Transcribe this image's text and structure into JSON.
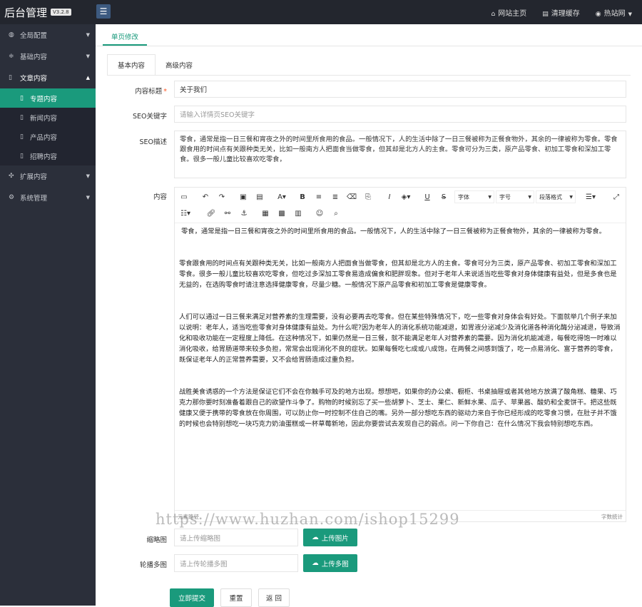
{
  "app": {
    "title": "后台管理",
    "version": "V3.2.8"
  },
  "top_nav": {
    "site_home": "网站主页",
    "clear_cache": "清理缓存",
    "user": "热站网"
  },
  "sidebar": {
    "items": [
      {
        "label": "全局配置",
        "icon": "globe-icon"
      },
      {
        "label": "基础内容",
        "icon": "sliders-icon"
      },
      {
        "label": "文章内容",
        "icon": "file-icon"
      },
      {
        "label": "扩展内容",
        "icon": "expand-icon"
      },
      {
        "label": "系统管理",
        "icon": "gear-icon"
      }
    ],
    "sub_items": [
      {
        "label": "专题内容"
      },
      {
        "label": "新闻内容"
      },
      {
        "label": "产品内容"
      },
      {
        "label": "招聘内容"
      }
    ]
  },
  "page_tab": "单页修改",
  "sub_tabs": [
    "基本内容",
    "高级内容"
  ],
  "form": {
    "title_label": "内容标题",
    "title_required": "*",
    "title_value": "关于我们",
    "seo_kw_label": "SEO关键字",
    "seo_kw_placeholder": "请输入详情页SEO关键字",
    "seo_desc_label": "SEO描述",
    "seo_desc_value": "零食，通常是指一日三餐和宵夜之外的时间里所食用的食品。一般情况下，人的生活中除了一日三餐被称为正餐食物外，其余的一律被称为零食。零食跟食用的时间点有关跟种类无关，比如一般南方人把面食当做零食，但其却是北方人的主食。零食可分为三类，原产品零食、初加工零食和深加工零食。很多一般儿童比较喜欢吃零食，",
    "content_label": "内容",
    "thumb_label": "缩略图",
    "thumb_placeholder": "请上传缩略图",
    "thumb_button": "上传图片",
    "carousel_label": "轮播多图",
    "carousel_placeholder": "请上传轮播多图",
    "carousel_button": "上传多图",
    "submit": "立即提交",
    "reset": "重置",
    "back": "返 回"
  },
  "editor": {
    "font_select": "字体",
    "size_select": "字号",
    "para_select": "段落格式",
    "status_left": "元素路径",
    "status_right": "字数统计",
    "paragraphs": [
      "零食，通常是指一日三餐和宵夜之外的时间里所食用的食品。一般情况下，人的生活中除了一日三餐被称为正餐食物外，其余的一律被称为零食。",
      "零食跟食用的时间点有关跟种类无关，比如一般南方人把面食当做零食，但其却是北方人的主食。零食可分为三类，原产品零食、初加工零食和深加工零食。很多一般儿童比较喜欢吃零食，但吃过多深加工零食易造成偏食和肥胖现象。但对于老年人来说适当吃些零食对身体健康有益处，但是多食也是无益的，在选购零食时请注意选择健康零食，尽量少糖。一般情况下原产品零食和初加工零食是健康零食。",
      "人们可以通过一日三餐来满足对营养素的生理需要，没有必要再去吃零食。但在某些特殊情况下，吃一些零食对身体会有好处。下面就举几个例子来加以说明：老年人，适当吃些零食对身体健康有益处。为什么呢?因为老年人的消化系统功能减退，如胃液分泌减少及消化道各种消化酶分泌减退，导致消化和吸收功能在一定程度上降低。在这种情况下，如果仍然是一日三餐，就不能满足老年人对营养素的需要。因为消化机能减退，每餐吃得饱一时难以消化吸收，给胃肠道带来较多负担，常常会出现消化不良的症状。如果每餐吃七成或八成饱，在两餐之间感到饿了，吃一点易消化、富于营养的零食，既保证老年人的正常营养需要，又不会给胃肠造成过重负担。",
      "战胜美食诱惑的一个方法是保证它们不会在你触手可及的地方出现。想想吧，如果你的办公桌、橱柜、书桌抽屉或者其他地方放满了酸角糕、糖果、巧克力那你要时刻准备着跟自己的欲望作斗争了。购物的时候别忘了买一些胡萝卜、芝士、果仁、新鲜水果、瓜子、苹果酱、酸奶和全麦饼干。把这些既健康又便于携带的零食放在你周围，可以防止你一时控制不住自己的嘴。另外一部分想吃东西的驱动力来自于你已经形成的吃零食习惯，在肚子并不饿的时候也会特别想吃一块巧克力奶油蛋糕或一杯草莓新地，因此你要尝试去发现自己的弱点。问一下你自己：在什么情况下我会特别想吃东西。"
    ]
  },
  "watermark": "https://www.huzhan.com/ishop15299",
  "colors": {
    "accent": "#1a9a7c",
    "topbar": "#23262e",
    "sidebar": "#2b2f3a"
  }
}
